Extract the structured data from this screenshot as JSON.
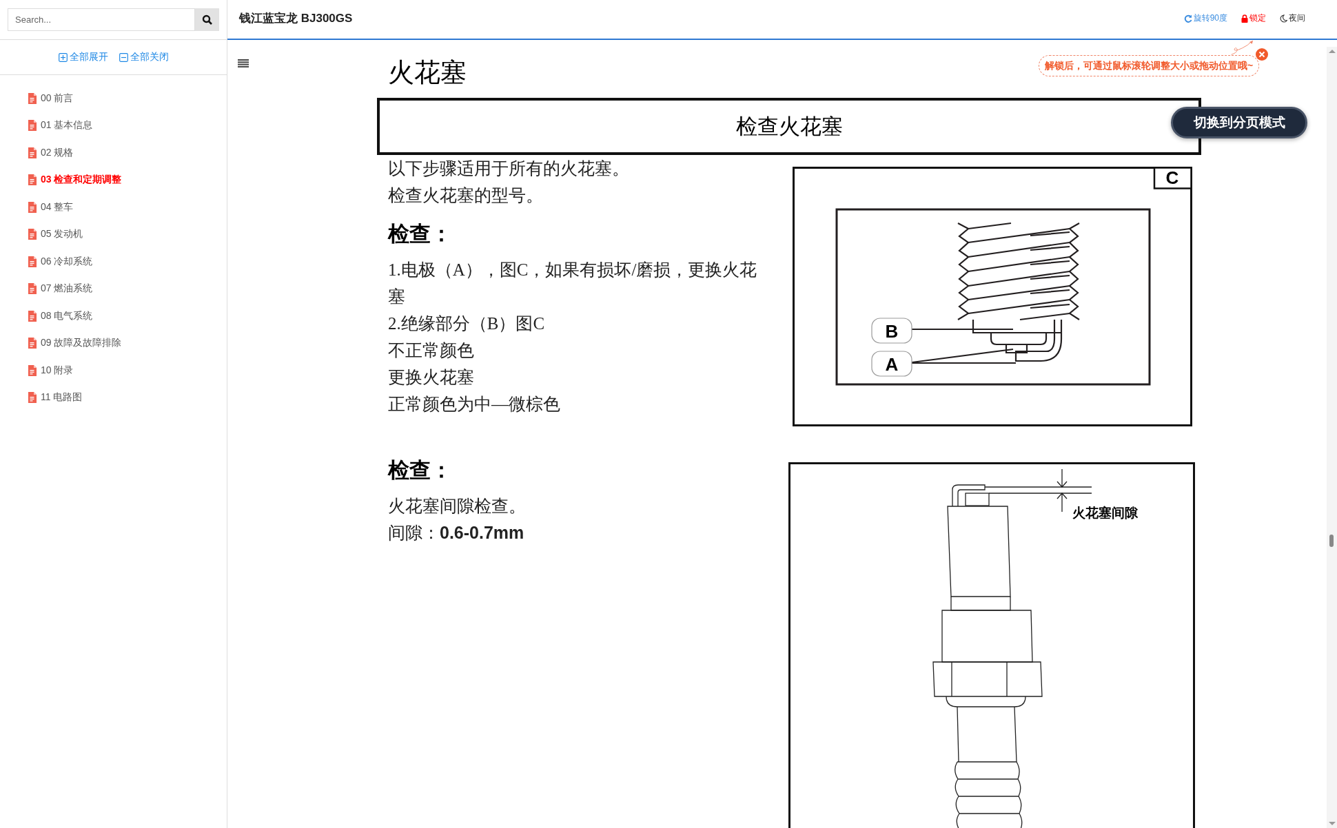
{
  "search": {
    "placeholder": "Search..."
  },
  "tree_actions": [
    {
      "label": "全部展开",
      "kind": "expand"
    },
    {
      "label": "全部关闭",
      "kind": "collapse"
    }
  ],
  "tree": [
    {
      "label": "00 前言",
      "selected": false
    },
    {
      "label": "01 基本信息",
      "selected": false
    },
    {
      "label": "02 规格",
      "selected": false
    },
    {
      "label": "03 检查和定期调整",
      "selected": true
    },
    {
      "label": "04 整车",
      "selected": false
    },
    {
      "label": "05 发动机",
      "selected": false
    },
    {
      "label": "06 冷却系统",
      "selected": false
    },
    {
      "label": "07 燃油系统",
      "selected": false
    },
    {
      "label": "08 电气系统",
      "selected": false
    },
    {
      "label": "09 故障及故障排除",
      "selected": false
    },
    {
      "label": "10 附录",
      "selected": false
    },
    {
      "label": "11 电路图",
      "selected": false
    }
  ],
  "header": {
    "title": "钱江蓝宝龙 BJ300GS",
    "actions": [
      {
        "label": "旋转90度",
        "kind": "rotate"
      },
      {
        "label": "锁定",
        "kind": "lock"
      },
      {
        "label": "夜间",
        "kind": "night"
      }
    ]
  },
  "tip": {
    "text": "解锁后，可通过鼠标滚轮调整大小或拖动位置哦~"
  },
  "switch_button": "切换到分页模式",
  "document": {
    "title": "火花塞",
    "section_title": "检查火花塞",
    "blocks": [
      {
        "kind": "para",
        "text": "以下步骤适用于所有的火花塞。"
      },
      {
        "kind": "para",
        "text": "检查火花塞的型号。"
      },
      {
        "kind": "heading",
        "text": "检查："
      },
      {
        "kind": "para",
        "text": "1.电极（A），图C，如果有损坏/磨损，更换火花塞"
      },
      {
        "kind": "para",
        "text": "2.绝缘部分（B）图C"
      },
      {
        "kind": "para",
        "text": "不正常颜色"
      },
      {
        "kind": "para",
        "text": "更换火花塞"
      },
      {
        "kind": "para",
        "text": "正常颜色为中—微棕色"
      },
      {
        "kind": "heading",
        "text": "检查："
      },
      {
        "kind": "para",
        "text": "火花塞间隙检查。"
      },
      {
        "kind": "para",
        "text": "间隙：**0.6-0.7mm**"
      }
    ],
    "figures": [
      {
        "kind": "electrode",
        "tag": "C",
        "labels": [
          "B",
          "A"
        ]
      },
      {
        "kind": "gap",
        "label": "火花塞间隙"
      }
    ]
  }
}
